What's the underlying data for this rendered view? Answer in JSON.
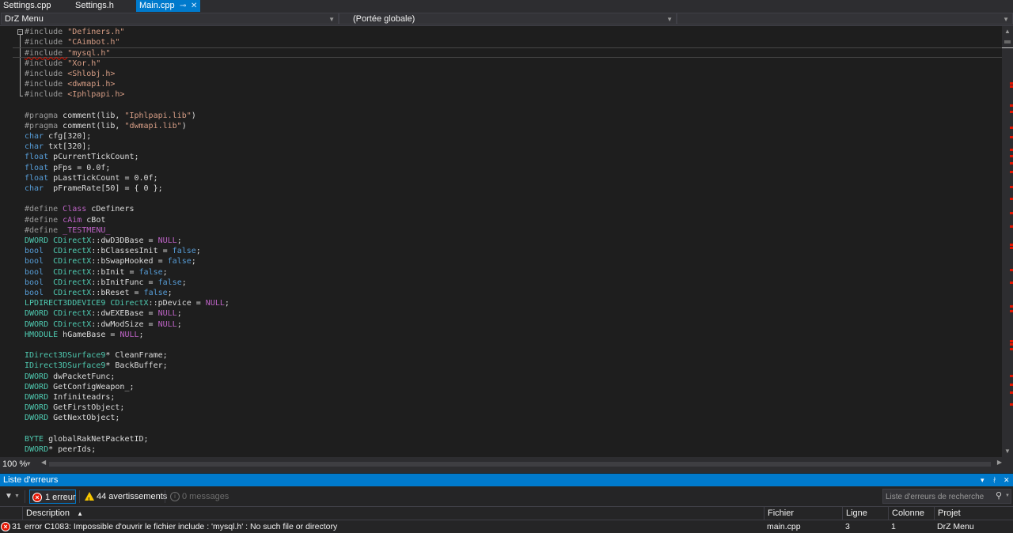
{
  "tabs": [
    {
      "label": "Settings.cpp",
      "active": false
    },
    {
      "label": "Settings.h",
      "active": false
    },
    {
      "label": "Main.cpp",
      "active": true
    }
  ],
  "tab_controls": {
    "pin_icon": "⊸",
    "close_icon": "✕"
  },
  "navigation": {
    "project_combo": "DrZ Menu",
    "scope_combo": "(Portée globale)",
    "member_combo": ""
  },
  "editor": {
    "current_line_index": 2,
    "lines": [
      [
        [
          "#include ",
          "#9b9b9b"
        ],
        [
          "\"Definers.h\"",
          "#d69d85"
        ]
      ],
      [
        [
          "#include ",
          "#9b9b9b"
        ],
        [
          "\"CAimbot.h\"",
          "#d69d85"
        ]
      ],
      [
        [
          "#include ",
          "#9b9b9b"
        ],
        [
          "\"mysql.h\"",
          "#d69d85"
        ]
      ],
      [
        [
          "#include ",
          "#9b9b9b"
        ],
        [
          "\"Xor.h\"",
          "#d69d85"
        ]
      ],
      [
        [
          "#include ",
          "#9b9b9b"
        ],
        [
          "<Shlobj.h>",
          "#d69d85"
        ]
      ],
      [
        [
          "#include ",
          "#9b9b9b"
        ],
        [
          "<dwmapi.h>",
          "#d69d85"
        ]
      ],
      [
        [
          "#include ",
          "#9b9b9b"
        ],
        [
          "<Iphlpapi.h>",
          "#d69d85"
        ]
      ],
      [],
      [
        [
          "#pragma ",
          "#9b9b9b"
        ],
        [
          "comment(lib, ",
          "#dcdcdc"
        ],
        [
          "\"Iphlpapi.lib\"",
          "#d69d85"
        ],
        [
          ")",
          "#dcdcdc"
        ]
      ],
      [
        [
          "#pragma ",
          "#9b9b9b"
        ],
        [
          "comment(lib, ",
          "#dcdcdc"
        ],
        [
          "\"dwmapi.lib\"",
          "#d69d85"
        ],
        [
          ")",
          "#dcdcdc"
        ]
      ],
      [
        [
          "char",
          "#569cd6"
        ],
        [
          " cfg[320];",
          "#dcdcdc"
        ]
      ],
      [
        [
          "char",
          "#569cd6"
        ],
        [
          " txt[320];",
          "#dcdcdc"
        ]
      ],
      [
        [
          "float",
          "#569cd6"
        ],
        [
          " pCurrentTickCount;",
          "#dcdcdc"
        ]
      ],
      [
        [
          "float",
          "#569cd6"
        ],
        [
          " pFps = 0.0f;",
          "#dcdcdc"
        ]
      ],
      [
        [
          "float",
          "#569cd6"
        ],
        [
          " pLastTickCount = 0.0f;",
          "#dcdcdc"
        ]
      ],
      [
        [
          "char",
          "#569cd6"
        ],
        [
          "  pFrameRate[50] = { 0 };",
          "#dcdcdc"
        ]
      ],
      [],
      [
        [
          "#define ",
          "#9b9b9b"
        ],
        [
          "Class",
          "#bd63c5"
        ],
        [
          " cDefiners",
          "#dcdcdc"
        ]
      ],
      [
        [
          "#define ",
          "#9b9b9b"
        ],
        [
          "cAim",
          "#bd63c5"
        ],
        [
          " cBot",
          "#dcdcdc"
        ]
      ],
      [
        [
          "#define ",
          "#9b9b9b"
        ],
        [
          "_TESTMENU_",
          "#bd63c5"
        ]
      ],
      [
        [
          "DWORD",
          "#4ec9b0"
        ],
        [
          " CDirectX",
          "#4ec9b0"
        ],
        [
          "::dwD3DBase = ",
          "#dcdcdc"
        ],
        [
          "NULL",
          "#bd63c5"
        ],
        [
          ";",
          "#dcdcdc"
        ]
      ],
      [
        [
          "bool",
          "#569cd6"
        ],
        [
          "  CDirectX",
          "#4ec9b0"
        ],
        [
          "::bClassesInit = ",
          "#dcdcdc"
        ],
        [
          "false",
          "#569cd6"
        ],
        [
          ";",
          "#dcdcdc"
        ]
      ],
      [
        [
          "bool",
          "#569cd6"
        ],
        [
          "  CDirectX",
          "#4ec9b0"
        ],
        [
          "::bSwapHooked = ",
          "#dcdcdc"
        ],
        [
          "false",
          "#569cd6"
        ],
        [
          ";",
          "#dcdcdc"
        ]
      ],
      [
        [
          "bool",
          "#569cd6"
        ],
        [
          "  CDirectX",
          "#4ec9b0"
        ],
        [
          "::bInit = ",
          "#dcdcdc"
        ],
        [
          "false",
          "#569cd6"
        ],
        [
          ";",
          "#dcdcdc"
        ]
      ],
      [
        [
          "bool",
          "#569cd6"
        ],
        [
          "  CDirectX",
          "#4ec9b0"
        ],
        [
          "::bInitFunc = ",
          "#dcdcdc"
        ],
        [
          "false",
          "#569cd6"
        ],
        [
          ";",
          "#dcdcdc"
        ]
      ],
      [
        [
          "bool",
          "#569cd6"
        ],
        [
          "  CDirectX",
          "#4ec9b0"
        ],
        [
          "::bReset = ",
          "#dcdcdc"
        ],
        [
          "false",
          "#569cd6"
        ],
        [
          ";",
          "#dcdcdc"
        ]
      ],
      [
        [
          "LPDIRECT3DDEVICE9",
          "#4ec9b0"
        ],
        [
          " CDirectX",
          "#4ec9b0"
        ],
        [
          "::pDevice = ",
          "#dcdcdc"
        ],
        [
          "NULL",
          "#bd63c5"
        ],
        [
          ";",
          "#dcdcdc"
        ]
      ],
      [
        [
          "DWORD",
          "#4ec9b0"
        ],
        [
          " CDirectX",
          "#4ec9b0"
        ],
        [
          "::dwEXEBase = ",
          "#dcdcdc"
        ],
        [
          "NULL",
          "#bd63c5"
        ],
        [
          ";",
          "#dcdcdc"
        ]
      ],
      [
        [
          "DWORD",
          "#4ec9b0"
        ],
        [
          " CDirectX",
          "#4ec9b0"
        ],
        [
          "::dwModSize = ",
          "#dcdcdc"
        ],
        [
          "NULL",
          "#bd63c5"
        ],
        [
          ";",
          "#dcdcdc"
        ]
      ],
      [
        [
          "HMODULE",
          "#4ec9b0"
        ],
        [
          " hGameBase = ",
          "#dcdcdc"
        ],
        [
          "NULL",
          "#bd63c5"
        ],
        [
          ";",
          "#dcdcdc"
        ]
      ],
      [],
      [
        [
          "IDirect3DSurface9",
          "#4ec9b0"
        ],
        [
          "* CleanFrame;",
          "#dcdcdc"
        ]
      ],
      [
        [
          "IDirect3DSurface9",
          "#4ec9b0"
        ],
        [
          "* BackBuffer;",
          "#dcdcdc"
        ]
      ],
      [
        [
          "DWORD",
          "#4ec9b0"
        ],
        [
          " dwPacketFunc;",
          "#dcdcdc"
        ]
      ],
      [
        [
          "DWORD",
          "#4ec9b0"
        ],
        [
          " GetConfigWeapon_;",
          "#dcdcdc"
        ]
      ],
      [
        [
          "DWORD",
          "#4ec9b0"
        ],
        [
          " Infiniteadrs;",
          "#dcdcdc"
        ]
      ],
      [
        [
          "DWORD",
          "#4ec9b0"
        ],
        [
          " GetFirstObject;",
          "#dcdcdc"
        ]
      ],
      [
        [
          "DWORD",
          "#4ec9b0"
        ],
        [
          " GetNextObject;",
          "#dcdcdc"
        ]
      ],
      [],
      [
        [
          "BYTE",
          "#4ec9b0"
        ],
        [
          " globalRakNetPacketID;",
          "#dcdcdc"
        ]
      ],
      [
        [
          "DWORD",
          "#4ec9b0"
        ],
        [
          "* peerIds;",
          "#dcdcdc"
        ]
      ]
    ],
    "scrollbar_error_markers": [
      104,
      108,
      132,
      140,
      160,
      172,
      188,
      196,
      205,
      216,
      235,
      250,
      268,
      285,
      308,
      312,
      340,
      356,
      386,
      392,
      430,
      434,
      440,
      474,
      485,
      495,
      510
    ]
  },
  "statusbar": {
    "zoom": "100 %"
  },
  "error_list": {
    "title": "Liste d'erreurs",
    "window_controls": {
      "dropdown_icon": "▾",
      "pin_icon": "ᚯ",
      "close_icon": "✕"
    },
    "filters": {
      "errors": "1 erreur",
      "warnings": "44 avertissements",
      "messages": "0 messages"
    },
    "search_placeholder": "Liste d'erreurs de recherche",
    "columns": {
      "description": "Description",
      "file": "Fichier",
      "line": "Ligne",
      "column": "Colonne",
      "project": "Projet"
    },
    "rows": [
      {
        "num": "31",
        "description": "error C1083: Impossible d'ouvrir le fichier include : 'mysql.h' : No such file or directory",
        "file": "main.cpp",
        "line": "3",
        "column": "1",
        "project": "DrZ Menu"
      }
    ]
  },
  "colors": {
    "accent": "#007acc",
    "error": "#e51400",
    "warning": "#f8c700",
    "background": "#1e1e1e",
    "panel": "#252526"
  }
}
